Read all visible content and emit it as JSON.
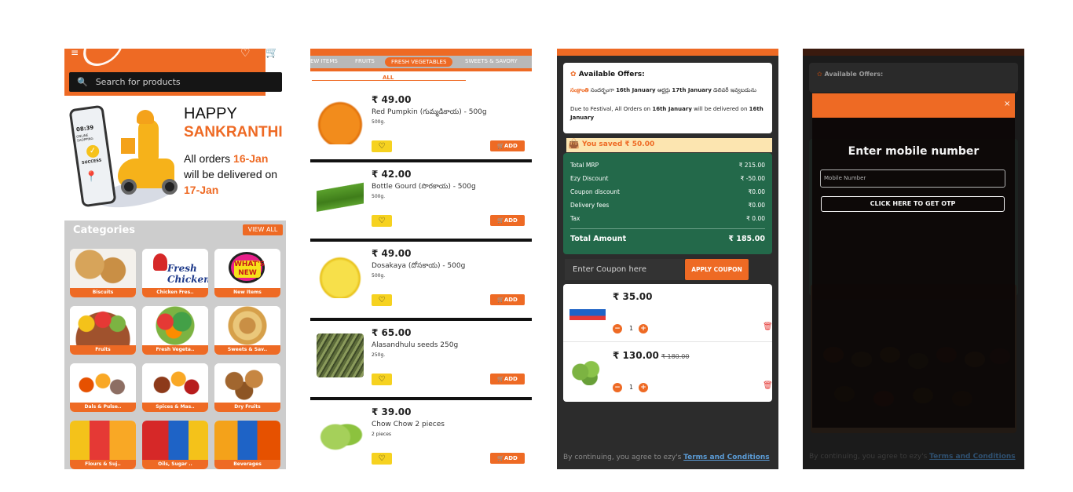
{
  "home": {
    "search_placeholder": "Search for products",
    "banner": {
      "happy": "HAPPY",
      "festival": "SANKRANTHI",
      "line1_prefix": "All orders ",
      "line1_date": "16-Jan",
      "line2": "will be delivered on",
      "line3": "17-Jan",
      "phone_time": "08:39",
      "phone_store": "ONLINE SHOPPING",
      "phone_status": "SUCCESS"
    },
    "categories_title": "Categories",
    "view_all": "VIEW ALL",
    "categories": [
      {
        "label": "Biscuits"
      },
      {
        "label": "Chicken Fres.."
      },
      {
        "label": "New Items",
        "badge": "WHAT'S NEW"
      },
      {
        "label": "Fruits"
      },
      {
        "label": "Fresh Vegeta.."
      },
      {
        "label": "Sweets & Sav.."
      },
      {
        "label": "Dals & Pulse.."
      },
      {
        "label": "Spices & Mas.."
      },
      {
        "label": "Dry Fruits"
      },
      {
        "label": "Flours & Suj.."
      },
      {
        "label": "Oils, Sugar .."
      },
      {
        "label": "Beverages"
      }
    ],
    "chicken_logo_text": "Fresh Chicken"
  },
  "products": {
    "tabs": [
      "EW ITEMS",
      "FRUITS",
      "FRESH VEGETABLES",
      "SWEETS & SAVORY"
    ],
    "subtab": "ALL",
    "add_label": "ADD",
    "items": [
      {
        "price": "₹ 49.00",
        "name": "Red Pumpkin (గుమ్మడికాయ) - 500g",
        "qty": "500g."
      },
      {
        "price": "₹ 42.00",
        "name": "Bottle Gourd (సొరకాయ) - 500g",
        "qty": "500g."
      },
      {
        "price": "₹ 49.00",
        "name": "Dosakaya (దోసకాయ) - 500g",
        "qty": "500g."
      },
      {
        "price": "₹ 65.00",
        "name": "Alasandhulu seeds 250g",
        "qty": "250g."
      },
      {
        "price": "₹ 39.00",
        "name": "Chow Chow 2 pieces",
        "qty": "2 pieces"
      }
    ]
  },
  "cart": {
    "offers_title": "Available Offers:",
    "offer_line1_a": "సంక్రాంతి",
    "offer_line1_b": " సందర్భంగా ",
    "offer_line1_c": "16th January",
    "offer_line1_d": " ఆర్డర్లు ",
    "offer_line1_e": "17th January",
    "offer_line1_f": " డెలివరీ ఇవ్వబడును",
    "offer_line2_a": "Due to Festival, All Orders on ",
    "offer_line2_b": "16th January",
    "offer_line2_c": " will be delivered on ",
    "offer_line2_d": "16th January",
    "saved": "You saved ₹ 50.00",
    "summary": [
      {
        "label": "Total MRP",
        "value": "₹ 215.00"
      },
      {
        "label": "Ezy Discount",
        "value": "₹ -50.00"
      },
      {
        "label": "Coupon discount",
        "value": "₹0.00"
      },
      {
        "label": "Delivery fees",
        "value": "₹0.00"
      },
      {
        "label": "Tax",
        "value": "₹ 0.00"
      }
    ],
    "total_label": "Total Amount",
    "total_value": "₹ 185.00",
    "coupon_placeholder": "Enter Coupon here",
    "apply_coupon": "APPLY COUPON",
    "items": [
      {
        "price": "₹ 35.00",
        "old_price": "",
        "qty": "1"
      },
      {
        "price": "₹ 130.00",
        "old_price": "₹ 180.00",
        "qty": "1"
      }
    ],
    "terms_prefix": "By continuing, you agree to ezy's ",
    "terms_link": "Terms and Conditions"
  },
  "login": {
    "offers_title": "Available Offers:",
    "title": "Enter mobile number",
    "mobile_placeholder": "Mobile Number",
    "otp_button": "CLICK HERE TO GET OTP",
    "close": "×",
    "terms_prefix": "By continuing, you agree to ezy's ",
    "terms_link": "Terms and Conditions"
  }
}
